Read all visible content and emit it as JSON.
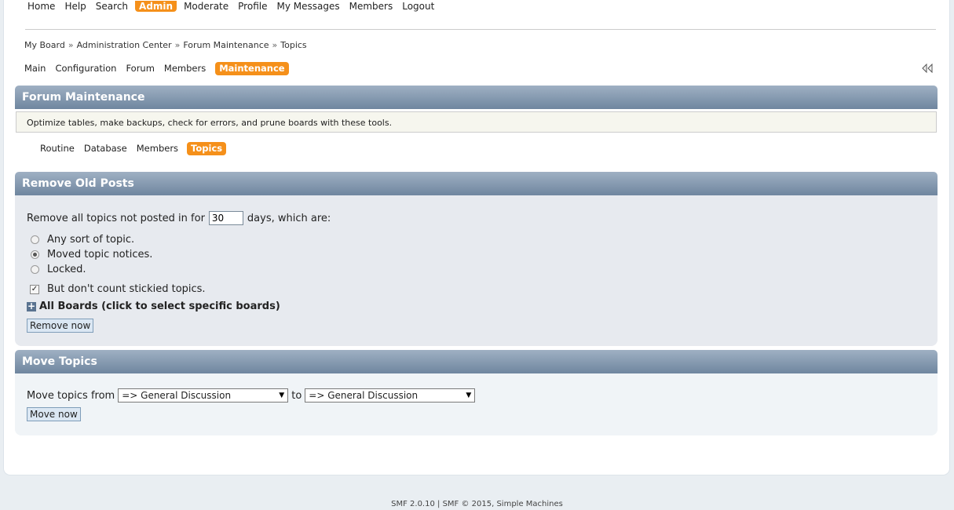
{
  "topnav": [
    "Home",
    "Help",
    "Search",
    "Admin",
    "Moderate",
    "Profile",
    "My Messages",
    "Members",
    "Logout"
  ],
  "topnav_active": "Admin",
  "breadcrumb": [
    "My Board",
    "Administration Center",
    "Forum Maintenance",
    "Topics"
  ],
  "breadcrumb_sep": "»",
  "adminnav": [
    "Main",
    "Configuration",
    "Forum",
    "Members",
    "Maintenance"
  ],
  "adminnav_active": "Maintenance",
  "maintenance": {
    "title": "Forum Maintenance",
    "description": "Optimize tables, make backups, check for errors, and prune boards with these tools."
  },
  "subtabs": [
    "Routine",
    "Database",
    "Members",
    "Topics"
  ],
  "subtabs_active": "Topics",
  "remove_old": {
    "title": "Remove Old Posts",
    "prefix": "Remove all topics not posted in for",
    "days_value": "30",
    "suffix": "days, which are:",
    "options": [
      "Any sort of topic.",
      "Moved topic notices.",
      "Locked."
    ],
    "selected_option": 1,
    "sticky_label": "But don't count stickied topics.",
    "sticky_checked": true,
    "boards_label": "All Boards (click to select specific boards)",
    "button": "Remove now"
  },
  "move_topics": {
    "title": "Move Topics",
    "from_label": "Move topics from",
    "from_value": "=> General Discussion",
    "to_label": "to",
    "to_value": "=> General Discussion",
    "button": "Move now"
  },
  "footer": "SMF 2.0.10 | SMF © 2015, Simple Machines",
  "colors": {
    "accent": "#f5901a",
    "header_top": "#9fb0c3",
    "header_bottom": "#6f869f"
  }
}
